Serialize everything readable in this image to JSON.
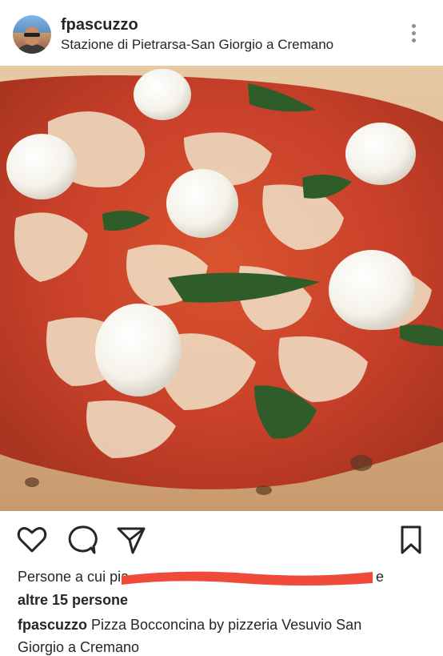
{
  "post": {
    "username": "fpascuzzo",
    "location": "Stazione di Pietrarsa-San Giorgio a Cremano",
    "likes_prefix": "Persone a cui pia",
    "likes_suffix": "e",
    "likes_others": "altre 15 persone",
    "caption_user": "fpascuzzo",
    "caption_text": " Pizza Bocconcina by pizzeria Vesuvio San",
    "caption_cont": "Giorgio a Cremano"
  },
  "icons": {
    "more": "more-vertical-icon",
    "like": "heart-icon",
    "comment": "comment-icon",
    "share": "paper-plane-icon",
    "save": "bookmark-icon"
  },
  "colors": {
    "text": "#262626",
    "secondary": "#8e8e8e",
    "redaction": "#f04a3a"
  }
}
